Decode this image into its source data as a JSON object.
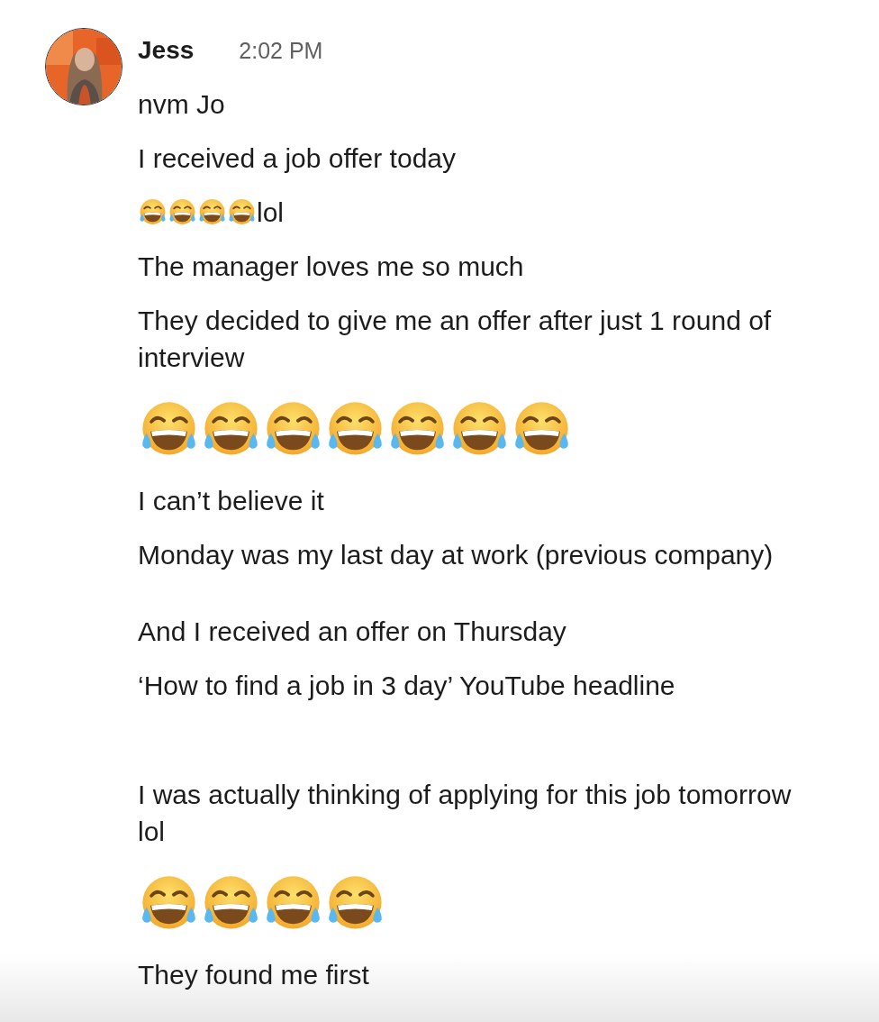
{
  "message_group": {
    "sender": "Jess",
    "time": "2:02 PM",
    "blocks": [
      {
        "messages": [
          {
            "kind": "text",
            "text": "nvm Jo"
          },
          {
            "kind": "text",
            "text": "I received a job offer today"
          },
          {
            "kind": "emoji_text",
            "emoji": [
              {
                "kind": "laughing_tears"
              },
              {
                "kind": "laughing_tears"
              },
              {
                "kind": "laughing_tears"
              },
              {
                "kind": "laughing_tears"
              }
            ],
            "text": "lol"
          },
          {
            "kind": "text",
            "text": "The manager loves me so much"
          },
          {
            "kind": "text",
            "text": "They decided to give me an offer after just 1 round of interview"
          },
          {
            "kind": "jumbo_emoji",
            "emoji": [
              {
                "kind": "laughing_tears"
              },
              {
                "kind": "laughing_tears"
              },
              {
                "kind": "laughing_tears"
              },
              {
                "kind": "laughing_tears"
              },
              {
                "kind": "laughing_tears"
              },
              {
                "kind": "laughing_tears"
              },
              {
                "kind": "laughing_tears"
              }
            ]
          },
          {
            "kind": "text",
            "text": "I can’t believe it"
          },
          {
            "kind": "text",
            "text": "Monday was my last day at work (previous company)"
          }
        ]
      },
      {
        "messages": [
          {
            "kind": "text",
            "text": "And I received an offer on Thursday"
          },
          {
            "kind": "text",
            "text": "‘How to find a job in 3 day’ YouTube headline"
          }
        ]
      },
      {
        "messages": [
          {
            "kind": "text",
            "text": "I was actually thinking of applying for this job tomorrow lol"
          },
          {
            "kind": "jumbo_emoji",
            "emoji": [
              {
                "kind": "laughing_tears"
              },
              {
                "kind": "laughing_tears"
              },
              {
                "kind": "laughing_tears"
              },
              {
                "kind": "laughing_tears"
              }
            ]
          },
          {
            "kind": "text",
            "text": "They found me first"
          }
        ]
      }
    ]
  }
}
